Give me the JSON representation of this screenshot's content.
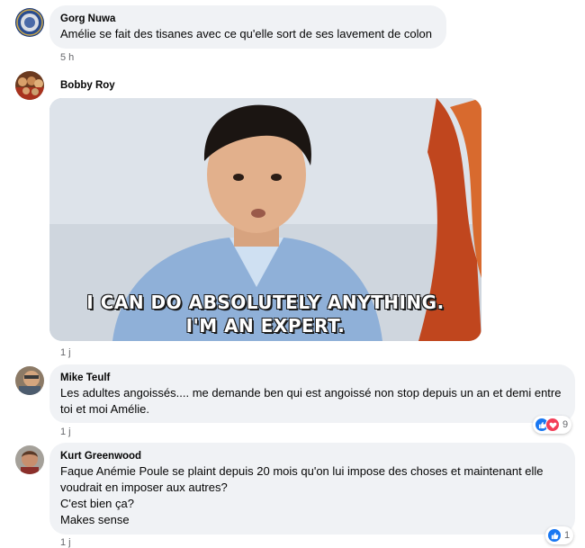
{
  "comments": [
    {
      "author": "Gorg Nuwa",
      "text": "Amélie se fait des tisanes avec ce qu'elle sort de ses lavement de colon",
      "time": "5 h"
    },
    {
      "author": "Bobby Roy",
      "time": "1 j",
      "gif_caption_line1": "I CAN DO ABSOLUTELY ANYTHING.",
      "gif_caption_line2": "I'M AN EXPERT."
    },
    {
      "author": "Mike Teulf",
      "text": "Les adultes angoissés.... me demande ben qui est angoissé non stop depuis un an et demi entre toi et moi Amélie.",
      "time": "1 j",
      "reaction_count": "9"
    },
    {
      "author": "Kurt Greenwood",
      "text": "Faque Anémie Poule se plaint depuis 20 mois qu'on lui impose des choses et maintenant elle voudrait en imposer aux autres?\nC'est bien ça?\nMakes sense",
      "time": "1 j",
      "reaction_count": "1"
    }
  ],
  "colors": {
    "bubble": "#f0f2f5",
    "like": "#1877f2",
    "love": "#f33e58",
    "meta_text": "#65676b"
  }
}
